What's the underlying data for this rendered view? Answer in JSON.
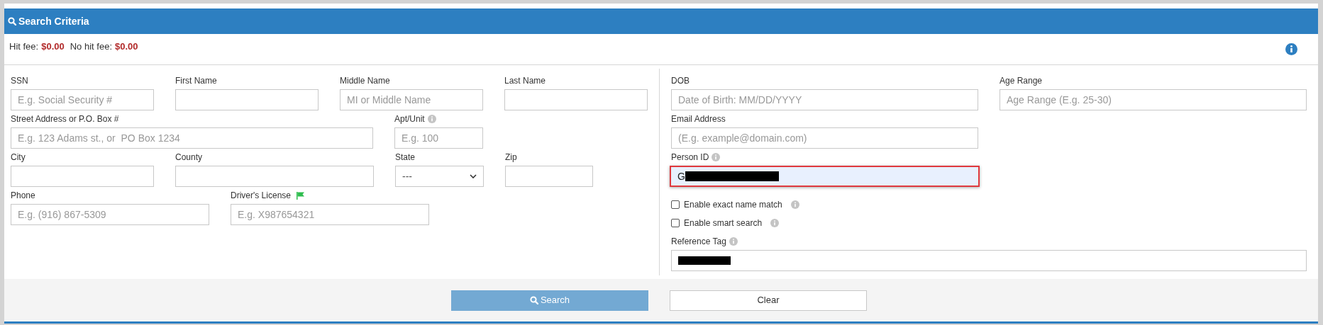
{
  "panel": {
    "title": "Search Criteria"
  },
  "fees": [
    {
      "label": "Hit fee:",
      "value": "$0.00"
    },
    {
      "label": "No hit fee:",
      "value": "$0.00"
    }
  ],
  "left_rows": [
    [
      {
        "label": "SSN",
        "placeholder": "E.g. Social Security #",
        "kind": "text"
      },
      {
        "label": "First Name",
        "kind": "text"
      },
      {
        "label": "Middle Name",
        "placeholder": "MI or Middle Name",
        "kind": "text"
      },
      {
        "label": "Last Name",
        "kind": "text"
      }
    ],
    [
      {
        "label": "Street Address or P.O. Box #",
        "placeholder": "E.g. 123 Adams st., or  PO Box 1234",
        "kind": "text"
      },
      {
        "label": "Apt/Unit",
        "placeholder": "E.g. 100",
        "kind": "text"
      }
    ],
    [
      {
        "label": "City",
        "kind": "text"
      },
      {
        "label": "County",
        "kind": "text"
      },
      {
        "label": "State",
        "value": "---",
        "kind": "select"
      },
      {
        "label": "Zip",
        "kind": "text"
      }
    ],
    [
      {
        "label": "Phone",
        "placeholder": "E.g. (916) 867-5309",
        "kind": "text"
      },
      {
        "label": "Driver's License",
        "placeholder": "E.g. X987654321",
        "kind": "text"
      }
    ]
  ],
  "right": {
    "dob": {
      "label": "DOB",
      "placeholder": "Date of Birth: MM/DD/YYYY"
    },
    "age_range": {
      "label": "Age Range",
      "placeholder": "Age Range (E.g. 25-30)"
    },
    "email": {
      "label": "Email Address",
      "placeholder": "(E.g. example@domain.com)"
    },
    "person_id": {
      "label": "Person ID",
      "value": "G",
      "highlighted": true
    },
    "options": [
      {
        "label": "Enable exact name match",
        "checked": false
      },
      {
        "label": "Enable smart search",
        "checked": false
      }
    ],
    "reference_tag": {
      "label": "Reference Tag"
    }
  },
  "buttons": [
    {
      "label": "Search",
      "kind": "primary"
    },
    {
      "label": "Clear",
      "kind": "secondary"
    }
  ]
}
